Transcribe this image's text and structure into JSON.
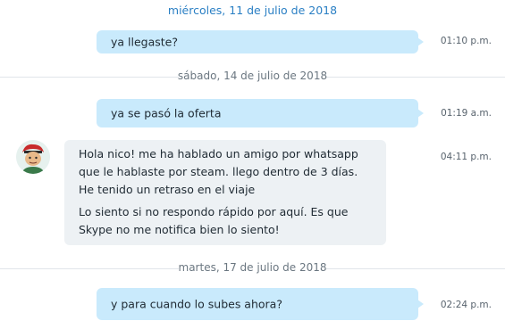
{
  "conversation": {
    "date_1": "miércoles, 11 de julio de 2018",
    "msg_1": {
      "text": "ya llegaste?",
      "time": "01:10 p.m."
    },
    "date_2": "sábado, 14 de julio de 2018",
    "msg_2": {
      "text": "ya se pasó la oferta",
      "time": "01:19 a.m."
    },
    "msg_3": {
      "lines_a": [
        "Hola nico! me ha hablado un amigo por whatsapp",
        "que le hablaste por steam.  llego dentro de 3 días.",
        "He tenido un retraso en el viaje"
      ],
      "lines_b": [
        "Lo siento si no respondo rápido por aquí. Es que",
        "Skype no me notifica bien lo siento!"
      ],
      "time": "04:11 p.m."
    },
    "date_3": "martes, 17 de julio de 2018",
    "msg_4": {
      "text": "y para cuando lo subes ahora?",
      "time": "02:24 p.m."
    }
  },
  "icons": {
    "avatar": "contact-avatar-icon"
  },
  "colors": {
    "outgoing_bubble": "#c9eafc",
    "incoming_bubble": "#edf1f4",
    "date_link": "#2a7fc4"
  }
}
